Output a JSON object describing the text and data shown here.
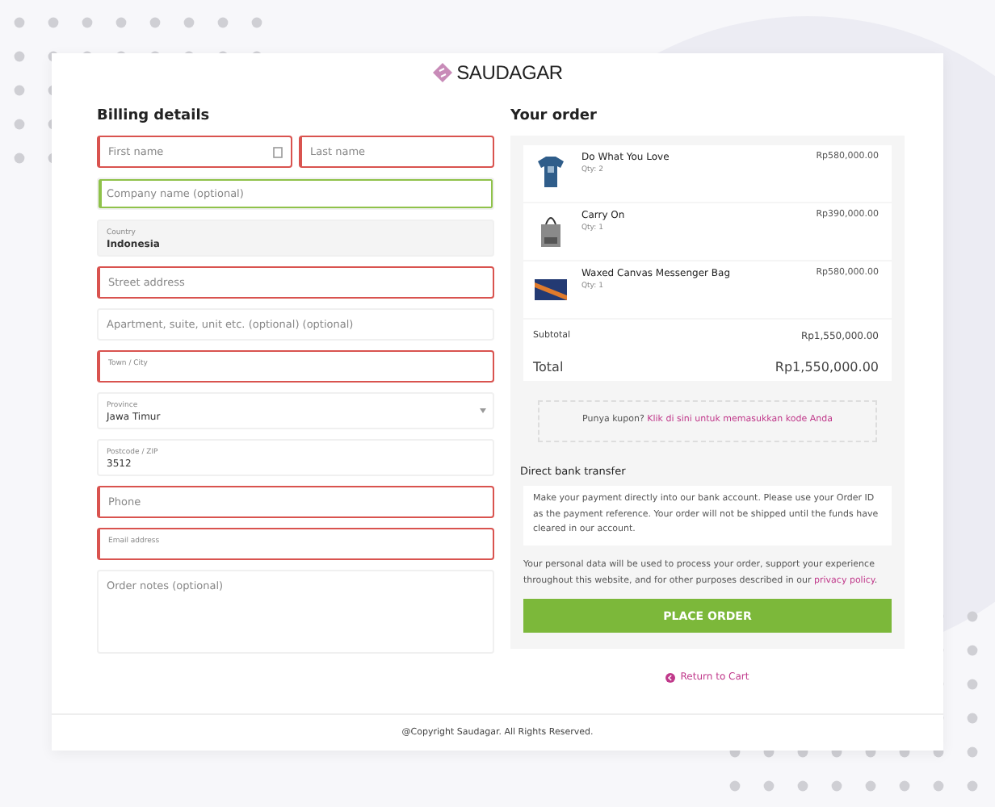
{
  "brand": {
    "name": "SAUDAGAR"
  },
  "billing": {
    "title": "Billing details",
    "rows": [
      [
        {
          "kind": "plain",
          "placeholder": "First name",
          "error": true,
          "valid": false,
          "has_icon": true
        },
        {
          "kind": "plain",
          "placeholder": "Last name",
          "error": true,
          "valid": false,
          "has_icon": false
        }
      ],
      [
        {
          "kind": "plain",
          "placeholder": "Company name (optional)",
          "error": false,
          "valid": true,
          "has_icon": false
        }
      ],
      [
        {
          "kind": "static",
          "label": "Country",
          "value": "Indonesia",
          "error": false,
          "valid": false,
          "has_icon": false
        }
      ],
      [
        {
          "kind": "plain",
          "placeholder": "Street address",
          "error": true,
          "valid": false,
          "has_icon": false
        }
      ],
      [
        {
          "kind": "plain",
          "placeholder": "Apartment, suite, unit etc. (optional) (optional)",
          "error": false,
          "valid": false,
          "has_icon": false
        }
      ],
      [
        {
          "kind": "floating",
          "label": "Town / City",
          "error": true,
          "valid": false,
          "has_icon": false
        }
      ],
      [
        {
          "kind": "select",
          "label": "Province",
          "value": "Jawa Timur",
          "error": false,
          "valid": false,
          "has_icon": false
        }
      ],
      [
        {
          "kind": "floating",
          "label": "Postcode / ZIP",
          "value": "3512",
          "error": false,
          "valid": false,
          "has_icon": false
        }
      ],
      [
        {
          "kind": "plain",
          "placeholder": "Phone",
          "error": true,
          "valid": false,
          "has_icon": false
        }
      ],
      [
        {
          "kind": "floating",
          "label": "Email address",
          "error": true,
          "valid": false,
          "has_icon": false
        }
      ],
      [
        {
          "kind": "textarea",
          "placeholder": "Order notes (optional)",
          "error": false,
          "valid": false,
          "has_icon": false
        }
      ]
    ]
  },
  "order": {
    "title": "Your order",
    "items": [
      {
        "name": "Do What You Love",
        "qty": "Qty: 2",
        "price": "Rp580,000.00"
      },
      {
        "name": "Carry On",
        "qty": "Qty: 1",
        "price": "Rp390,000.00"
      },
      {
        "name": "Waxed Canvas Messenger Bag",
        "qty": "Qty: 1",
        "price": "Rp580,000.00"
      }
    ],
    "subtotal": {
      "label": "Subtotal",
      "value": "Rp1,550,000.00"
    },
    "total": {
      "label": "Total",
      "value": "Rp1,550,000.00"
    },
    "coupon": {
      "text": "Punya kupon?",
      "link": "Klik di sini untuk memasukkan kode Anda"
    },
    "payment": {
      "title": "Direct bank transfer",
      "description": "Make your payment directly into our bank account. Please use your Order ID as the payment reference. Your order will not be shipped until the funds have cleared in our account."
    },
    "privacy": {
      "text": "Your personal data will be used to process your order, support your experience throughout this website, and for other purposes described in our",
      "link": "privacy policy",
      "end": "."
    },
    "button": "PLACE ORDER",
    "return_link": "Return to Cart"
  },
  "footer": "@Copyright Saudagar. All Rights Reserved."
}
